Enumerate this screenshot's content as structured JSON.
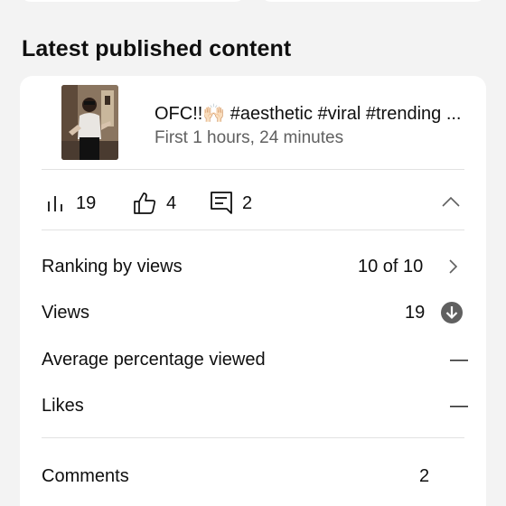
{
  "section": {
    "title": "Latest published content"
  },
  "video": {
    "title": "OFC!!🙌🏻 #aesthetic #viral #trending ...",
    "subtitle": "First 1 hours, 24 minutes",
    "thumbnail_icon": "video-thumbnail"
  },
  "stats": {
    "views": "19",
    "likes": "4",
    "comments": "2",
    "views_icon": "bar-chart-icon",
    "likes_icon": "thumbs-up-icon",
    "comments_icon": "comment-icon",
    "collapse_icon": "chevron-up-icon"
  },
  "metrics": {
    "ranking": {
      "label": "Ranking by views",
      "value": "10 of 10",
      "icon": "chevron-right-icon"
    },
    "views": {
      "label": "Views",
      "value": "19",
      "icon": "arrow-down-circle-icon"
    },
    "avg_viewed": {
      "label": "Average percentage viewed",
      "value": "—"
    },
    "likes": {
      "label": "Likes",
      "value": "—"
    },
    "comments": {
      "label": "Comments",
      "value": "2"
    }
  },
  "colors": {
    "background": "#f3f3f3",
    "card": "#ffffff",
    "text_primary": "#0f0f0f",
    "text_secondary": "#606060",
    "divider": "#e2e2e2",
    "icon_dark": "#606060"
  }
}
